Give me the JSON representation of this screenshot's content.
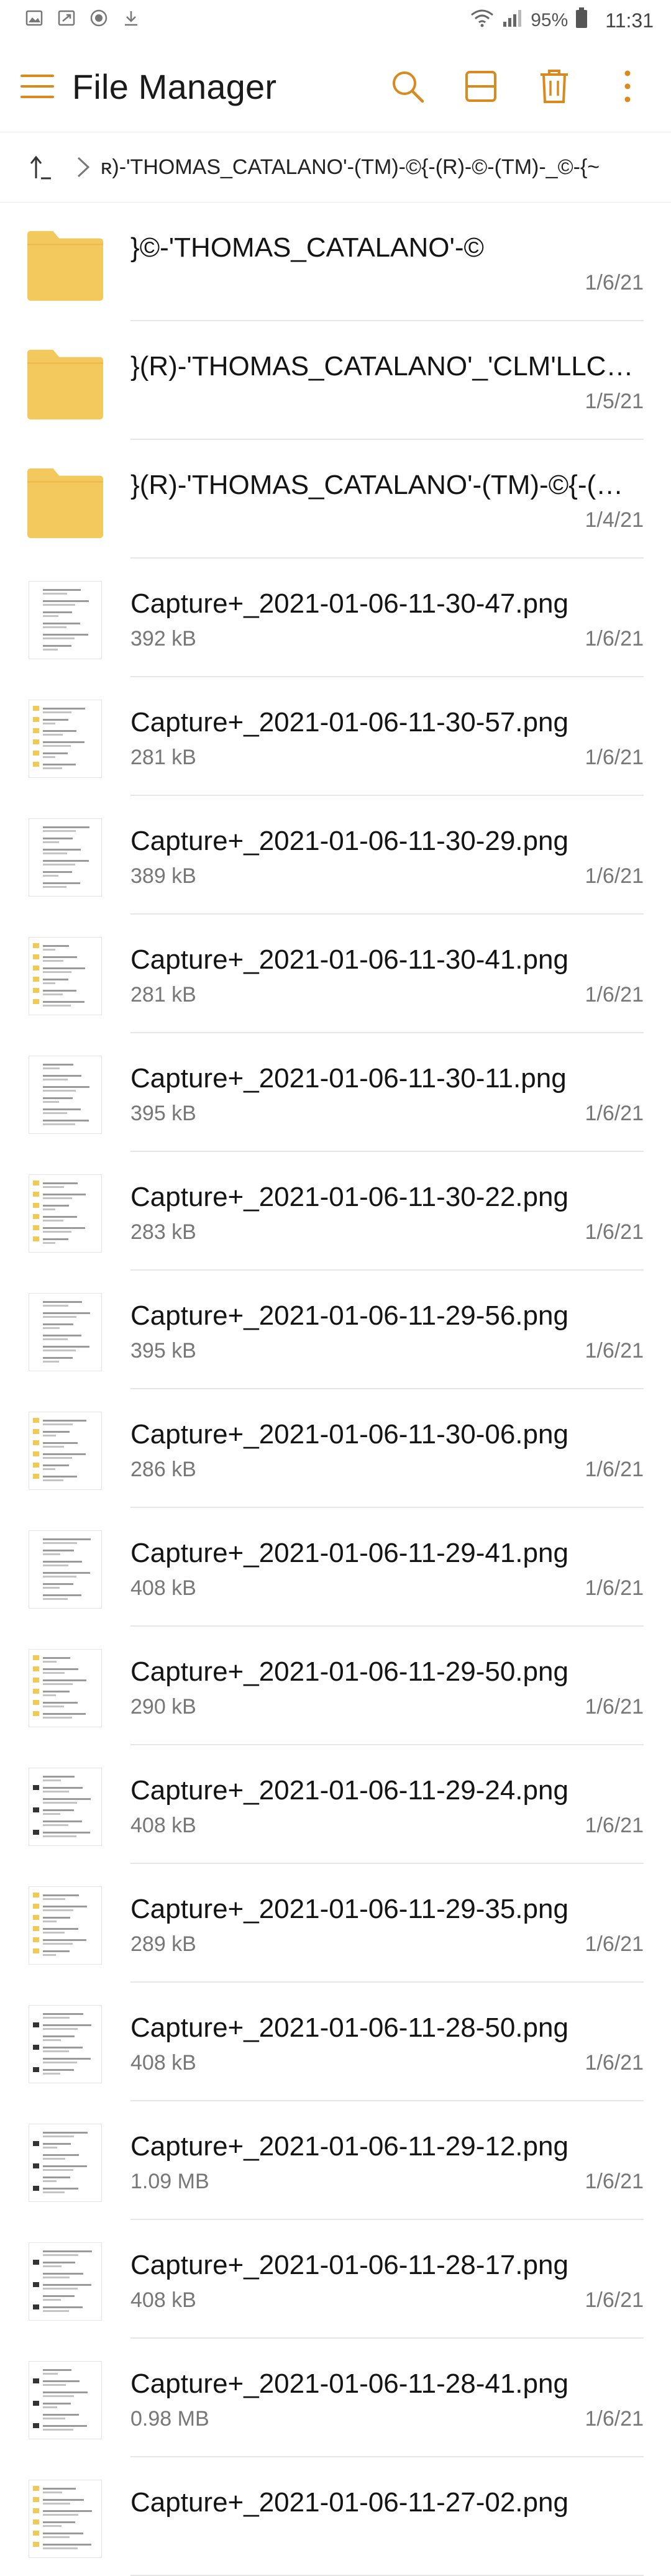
{
  "status_bar": {
    "left_icons": [
      "gallery-icon",
      "screenshot-icon",
      "vpn-icon",
      "download-icon"
    ],
    "battery_percent": "95%",
    "time": "11:31"
  },
  "app_bar": {
    "title": "File Manager",
    "accent_color": "#d98a1f",
    "actions": [
      "search-icon",
      "view-layout-icon",
      "delete-icon",
      "more-icon"
    ]
  },
  "path_bar": {
    "path": "ʀ)-'THOMAS_CATALANO'-(TM)-©{-(R)-©-(TM)-_©-{~"
  },
  "items": [
    {
      "type": "folder",
      "name": "}©-'THOMAS_CATALANO'-©",
      "size": "",
      "date": "1/6/21"
    },
    {
      "type": "folder",
      "name": "}(R)-'THOMAS_CATALANO'_'CLM'LLC-(...",
      "size": "",
      "date": "1/5/21"
    },
    {
      "type": "folder",
      "name": "}(R)-'THOMAS_CATALANO'-(TM)-©{-(R)...",
      "size": "",
      "date": "1/4/21"
    },
    {
      "type": "image",
      "thumb": "plain",
      "name": "Capture+_2021-01-06-11-30-47.png",
      "size": "392 kB",
      "date": "1/6/21"
    },
    {
      "type": "image",
      "thumb": "folders",
      "name": "Capture+_2021-01-06-11-30-57.png",
      "size": "281 kB",
      "date": "1/6/21"
    },
    {
      "type": "image",
      "thumb": "plain",
      "name": "Capture+_2021-01-06-11-30-29.png",
      "size": "389 kB",
      "date": "1/6/21"
    },
    {
      "type": "image",
      "thumb": "folders",
      "name": "Capture+_2021-01-06-11-30-41.png",
      "size": "281 kB",
      "date": "1/6/21"
    },
    {
      "type": "image",
      "thumb": "plain",
      "name": "Capture+_2021-01-06-11-30-11.png",
      "size": "395 kB",
      "date": "1/6/21"
    },
    {
      "type": "image",
      "thumb": "folders",
      "name": "Capture+_2021-01-06-11-30-22.png",
      "size": "283 kB",
      "date": "1/6/21"
    },
    {
      "type": "image",
      "thumb": "plain",
      "name": "Capture+_2021-01-06-11-29-56.png",
      "size": "395 kB",
      "date": "1/6/21"
    },
    {
      "type": "image",
      "thumb": "folders",
      "name": "Capture+_2021-01-06-11-30-06.png",
      "size": "286 kB",
      "date": "1/6/21"
    },
    {
      "type": "image",
      "thumb": "plain",
      "name": "Capture+_2021-01-06-11-29-41.png",
      "size": "408 kB",
      "date": "1/6/21"
    },
    {
      "type": "image",
      "thumb": "folders",
      "name": "Capture+_2021-01-06-11-29-50.png",
      "size": "290 kB",
      "date": "1/6/21"
    },
    {
      "type": "image",
      "thumb": "dark",
      "name": "Capture+_2021-01-06-11-29-24.png",
      "size": "408 kB",
      "date": "1/6/21"
    },
    {
      "type": "image",
      "thumb": "folders",
      "name": "Capture+_2021-01-06-11-29-35.png",
      "size": "289 kB",
      "date": "1/6/21"
    },
    {
      "type": "image",
      "thumb": "dark",
      "name": "Capture+_2021-01-06-11-28-50.png",
      "size": "408 kB",
      "date": "1/6/21"
    },
    {
      "type": "image",
      "thumb": "dark",
      "name": "Capture+_2021-01-06-11-29-12.png",
      "size": "1.09 MB",
      "date": "1/6/21"
    },
    {
      "type": "image",
      "thumb": "dark",
      "name": "Capture+_2021-01-06-11-28-17.png",
      "size": "408 kB",
      "date": "1/6/21"
    },
    {
      "type": "image",
      "thumb": "dark",
      "name": "Capture+_2021-01-06-11-28-41.png",
      "size": "0.98 MB",
      "date": "1/6/21"
    },
    {
      "type": "image",
      "thumb": "folders",
      "name": "Capture+_2021-01-06-11-27-02.png",
      "size": "",
      "date": ""
    }
  ]
}
